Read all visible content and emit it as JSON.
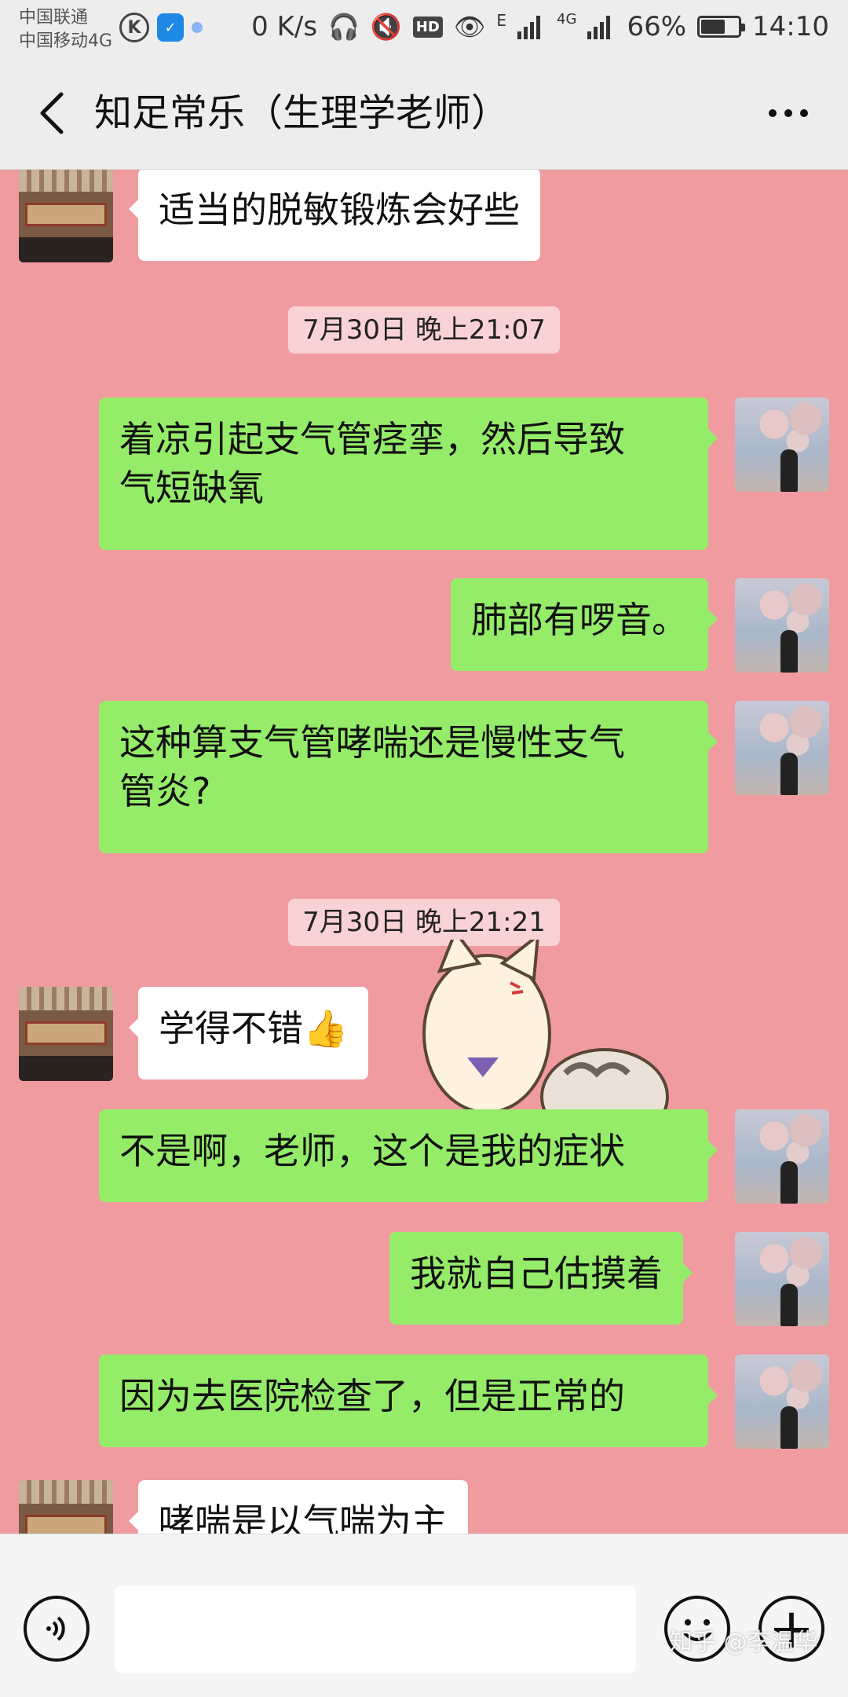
{
  "status_bar": {
    "carrier_1": "中国联通",
    "carrier_2": "中国移动4G",
    "network_speed": "0 K/s",
    "hd_label": "HD",
    "network_type_1": "E",
    "network_type_2": "4G",
    "battery_percent": "66%",
    "battery_level": 0.66,
    "time": "14:10"
  },
  "header": {
    "title": "知足常乐（生理学老师）"
  },
  "messages": [
    {
      "side": "left",
      "text": "适当的脱敏锻炼会好些"
    },
    {
      "timestamp": "7月30日 晚上21:07"
    },
    {
      "side": "right",
      "line1": "着凉引起支气管痉挛，然后导致",
      "line2": "气短缺氧"
    },
    {
      "side": "right",
      "text": "肺部有啰音。"
    },
    {
      "side": "right",
      "line1": "这种算支气管哮喘还是慢性支气",
      "line2": "管炎?"
    },
    {
      "timestamp": "7月30日 晚上21:21"
    },
    {
      "side": "left",
      "text": "学得不错👍"
    },
    {
      "side": "right",
      "text": "不是啊，老师，这个是我的症状"
    },
    {
      "side": "right",
      "text": "我就自己估摸着"
    },
    {
      "side": "right",
      "text": "因为去医院检查了，但是正常的"
    },
    {
      "side": "left",
      "text": "哮喘是以气喘为主"
    }
  ],
  "watermark": "知乎 @李温华",
  "icons": {
    "back": "chevron-left-icon",
    "more": "more-dots-icon",
    "voice": "voice-icon",
    "emoji": "emoji-icon",
    "plus": "plus-icon"
  }
}
